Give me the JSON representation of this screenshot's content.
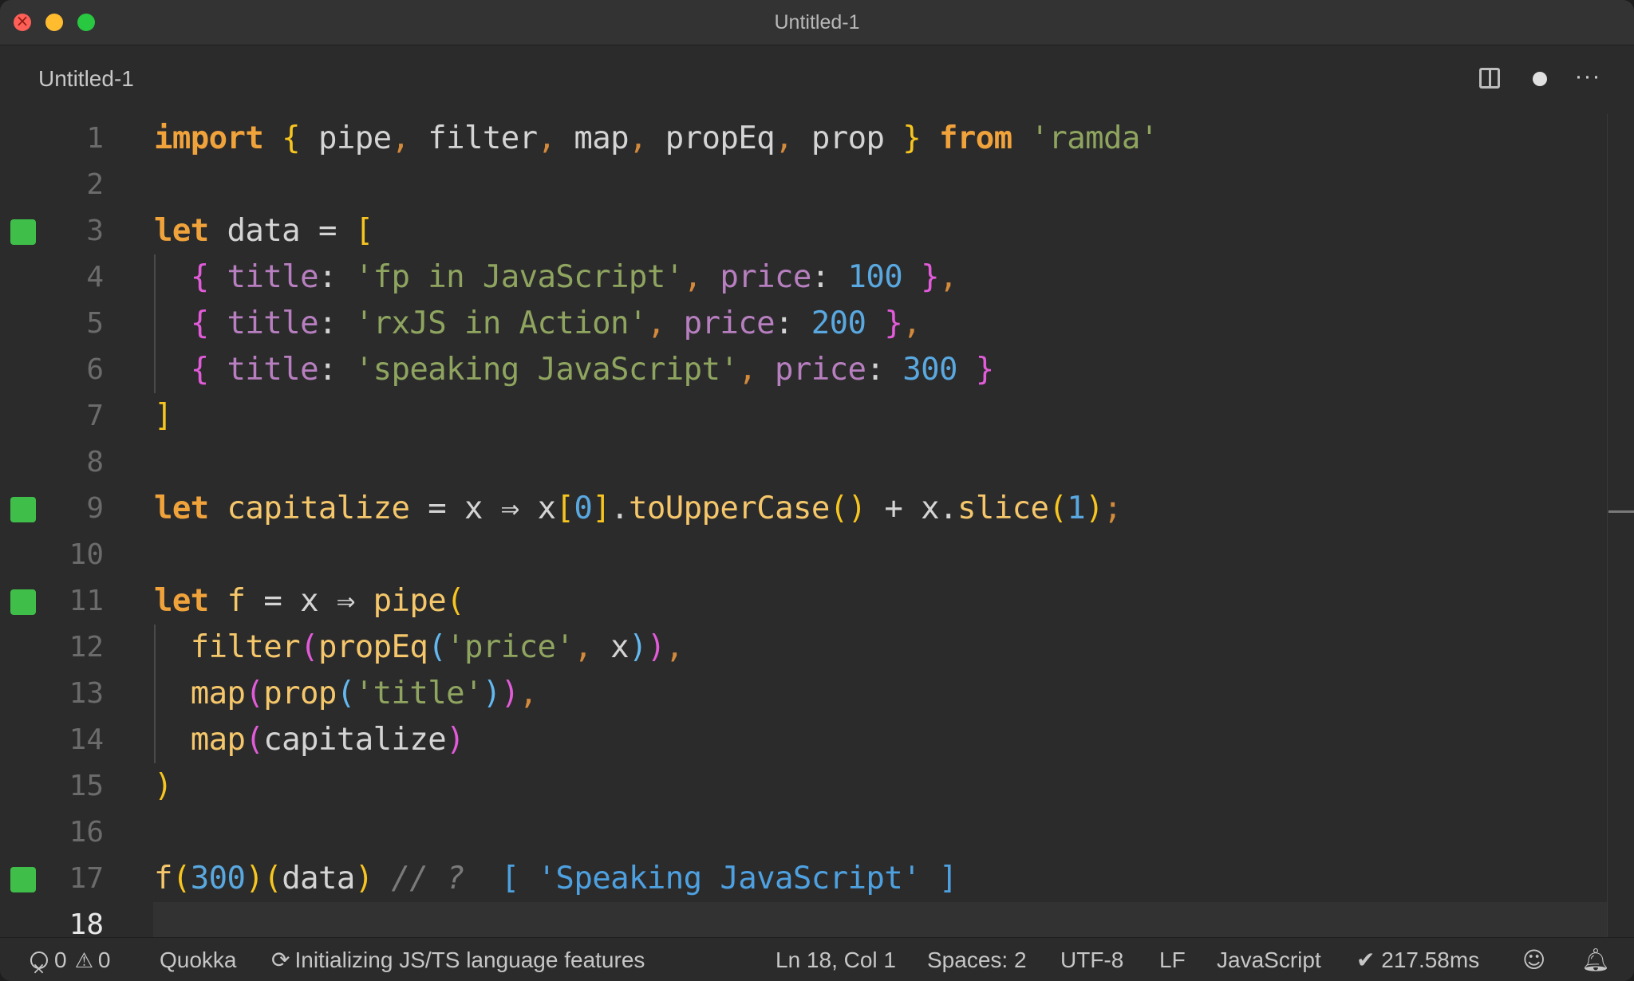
{
  "window": {
    "title": "Untitled-1"
  },
  "tab": {
    "label": "Untitled-1",
    "actions": [
      "split-editor-icon",
      "unsaved-dot-icon",
      "more-actions-icon"
    ],
    "more_label": "···"
  },
  "editor": {
    "language": "JavaScript",
    "line_numbers": [
      "1",
      "2",
      "3",
      "4",
      "5",
      "6",
      "7",
      "8",
      "9",
      "10",
      "11",
      "12",
      "13",
      "14",
      "15",
      "16",
      "17",
      "18"
    ],
    "current_line": 18,
    "quokka_markers_on_lines": [
      3,
      9,
      11,
      17
    ],
    "marker_color": "#3fbf4a",
    "lines": [
      "import { pipe, filter, map, propEq, prop } from 'ramda'",
      "",
      "let data = [",
      "  { title: 'fp in JavaScript', price: 100 },",
      "  { title: 'rxJS in Action', price: 200 },",
      "  { title: 'speaking JavaScript', price: 300 }",
      "]",
      "",
      "let capitalize = x ⇒ x[0].toUpperCase() + x.slice(1);",
      "",
      "let f = x ⇒ pipe(",
      "  filter(propEq('price', x)),",
      "  map(prop('title')),",
      "  map(capitalize)",
      ")",
      "",
      "f(300)(data) // ?  [ 'Speaking JavaScript' ]",
      ""
    ],
    "inline_result": "[ 'Speaking JavaScript' ]"
  },
  "statusbar": {
    "errors": "0",
    "warnings": "0",
    "quokka": "Quokka",
    "language_status": "Initializing JS/TS language features",
    "cursor": "Ln 18, Col 1",
    "indent": "Spaces: 2",
    "encoding": "UTF-8",
    "eol": "LF",
    "language": "JavaScript",
    "timing": "✔ 217.58ms"
  }
}
